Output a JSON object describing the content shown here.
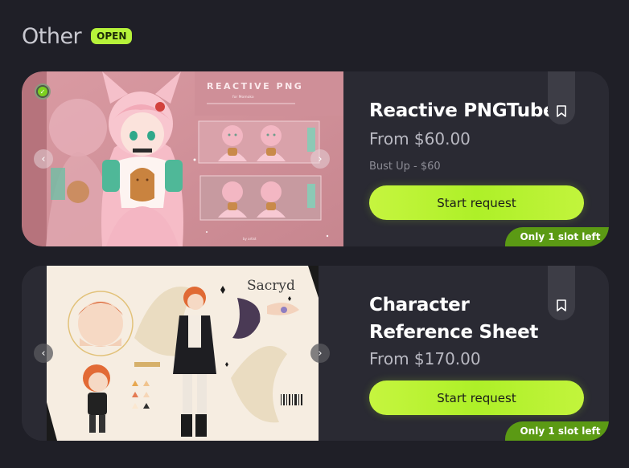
{
  "section": {
    "title": "Other",
    "status_badge": "OPEN"
  },
  "listings": [
    {
      "title": "Reactive PNGTuber",
      "price": "From $60.00",
      "variant": "Bust Up - $60",
      "cta_label": "Start request",
      "slots_label": "Only 1 slot left",
      "image_text": {
        "heading": "REACTIVE PNG",
        "subheading": "for Momoko"
      },
      "icons": {
        "prev": "chevron-left-icon",
        "next": "chevron-right-icon",
        "bookmark": "bookmark-icon",
        "verified": "verified-badge-icon"
      }
    },
    {
      "title": "Character Reference Sheet",
      "price": "From $170.00",
      "cta_label": "Start request",
      "slots_label": "Only 1 slot left",
      "image_text": {
        "character_name": "Sacryd"
      },
      "icons": {
        "prev": "chevron-left-icon",
        "next": "chevron-right-icon",
        "bookmark": "bookmark-icon"
      }
    }
  ],
  "colors": {
    "background": "#1f1f27",
    "card": "#2a2a33",
    "accent": "#b6f23a",
    "slot_tag": "#5b9a14"
  }
}
